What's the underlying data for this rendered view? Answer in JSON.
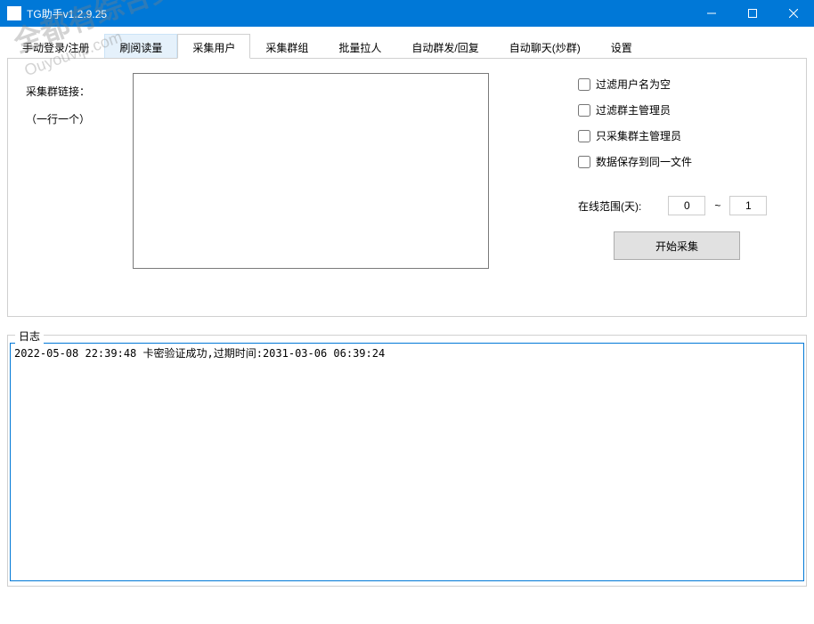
{
  "window": {
    "title": "TG助手v1.2.9.25"
  },
  "tabs": [
    {
      "label": "手动登录/注册"
    },
    {
      "label": "刷阅读量"
    },
    {
      "label": "采集用户"
    },
    {
      "label": "采集群组"
    },
    {
      "label": "批量拉人"
    },
    {
      "label": "自动群发/回复"
    },
    {
      "label": "自动聊天(炒群)"
    },
    {
      "label": "设置"
    }
  ],
  "panel": {
    "link_label": "采集群链接：",
    "link_hint": "（一行一个）",
    "textarea_value": "",
    "checkboxes": [
      {
        "label": "过滤用户名为空"
      },
      {
        "label": "过滤群主管理员"
      },
      {
        "label": "只采集群主管理员"
      },
      {
        "label": "数据保存到同一文件"
      }
    ],
    "range_label": "在线范围(天):",
    "range_from": "0",
    "range_to": "1",
    "start_button": "开始采集"
  },
  "log": {
    "title": "日志",
    "content": "2022-05-08 22:39:48 卡密验证成功,过期时间:2031-03-06 06:39:24"
  },
  "watermark": {
    "line1": "全都有综合资源网",
    "line2": "Ouyouvip.com"
  }
}
